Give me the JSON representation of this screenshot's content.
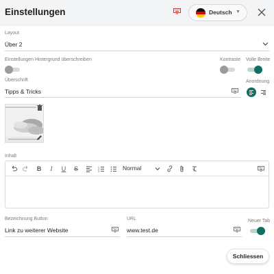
{
  "header": {
    "title": "Einstellungen",
    "language": "Deutsch"
  },
  "layout": {
    "label": "Layout",
    "value": "Über 2"
  },
  "toggles": {
    "override_bg_label": "Einstellungen Hintergrund überschreiben",
    "override_bg_on": false,
    "contrast_label": "Kontraste",
    "contrast_on": false,
    "full_width_label": "Volle Breite",
    "full_width_on": true
  },
  "heading": {
    "label": "Überschrift",
    "value": "Tipps & Tricks"
  },
  "arrangement": {
    "label": "Anordnung",
    "options": [
      "align-left-icon",
      "align-right-icon"
    ],
    "selected": "align-left-icon"
  },
  "content": {
    "label": "Inhalt",
    "format_value": "Normal",
    "toolbar": [
      "undo-icon",
      "redo-icon",
      "bold-icon",
      "italic-icon",
      "underline-icon",
      "strikethrough-icon",
      "align-icon",
      "ordered-list-icon",
      "bullet-list-icon",
      "format-select",
      "link-icon",
      "attachment-icon",
      "clear-format-icon",
      "keyboard-icon"
    ],
    "text": ""
  },
  "button_label": {
    "label": "Bezeichnung Button",
    "value": "Link zu weiterer Website"
  },
  "url": {
    "label": "URL",
    "value": "www.test.de"
  },
  "new_tab": {
    "label": "Neuer Tab",
    "on": true
  },
  "footer": {
    "close_label": "Schliessen"
  },
  "colors": {
    "accent": "#0f6f63",
    "toggle_off": "#9b9b9b",
    "header_bg": "#f3f4f6"
  }
}
